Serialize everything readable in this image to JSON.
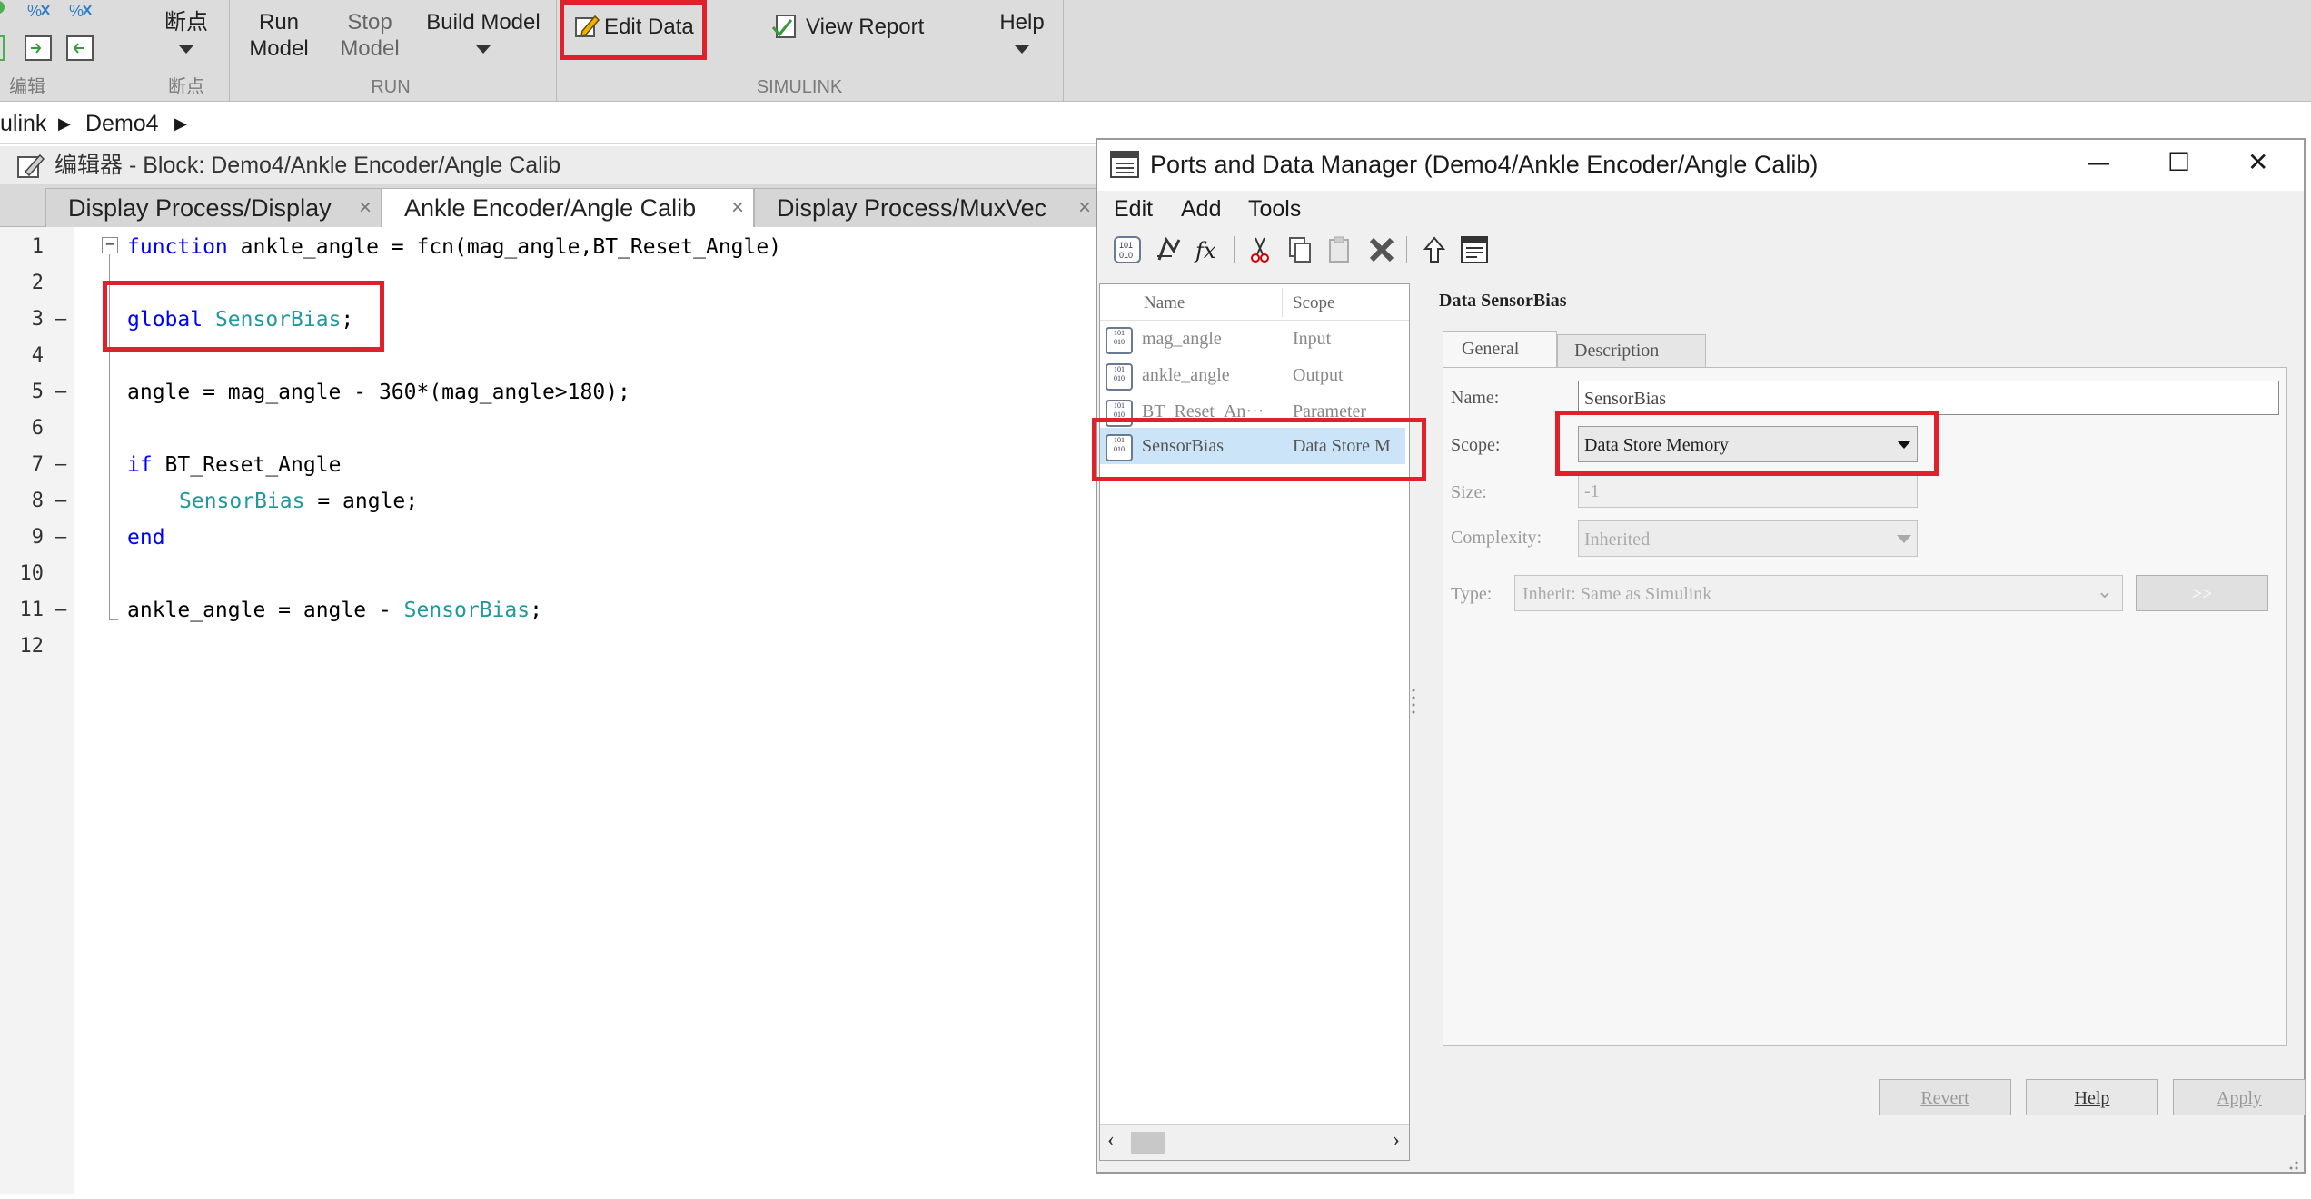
{
  "ribbon": {
    "breakpoints_label": "断点",
    "run_model": [
      "Run",
      "Model"
    ],
    "stop_model": [
      "Stop",
      "Model"
    ],
    "build_model": "Build Model",
    "edit_data": "Edit Data",
    "view_report": "View Report",
    "help": "Help",
    "sections": {
      "edit": "编辑",
      "breakpoints": "断点",
      "run": "RUN",
      "simulink": "SIMULINK"
    }
  },
  "breadcrumb": {
    "root": "ulink",
    "model": "Demo4"
  },
  "editor": {
    "title": "编辑器 - Block: Demo4/Ankle Encoder/Angle Calib",
    "tabs": [
      {
        "label": "Display Process/Display",
        "close": "×"
      },
      {
        "label": "Ankle Encoder/Angle Calib",
        "close": "×"
      },
      {
        "label": "Display Process/MuxVec",
        "close": "×"
      }
    ],
    "fold_marker": "−",
    "lines": [
      {
        "n": "1",
        "dash": ""
      },
      {
        "n": "2",
        "dash": ""
      },
      {
        "n": "3",
        "dash": "–"
      },
      {
        "n": "4",
        "dash": ""
      },
      {
        "n": "5",
        "dash": "–"
      },
      {
        "n": "6",
        "dash": ""
      },
      {
        "n": "7",
        "dash": "–"
      },
      {
        "n": "8",
        "dash": "–"
      },
      {
        "n": "9",
        "dash": "–"
      },
      {
        "n": "10",
        "dash": ""
      },
      {
        "n": "11",
        "dash": "–"
      },
      {
        "n": "12",
        "dash": ""
      }
    ],
    "code": {
      "l1_kw": "function",
      "l1_rest": " ankle_angle = fcn(mag_angle,BT_Reset_Angle)",
      "l3_kw": "global",
      "l3_var": " SensorBias",
      "l3_end": ";",
      "l5": "angle = mag_angle - 360*(mag_angle>180);",
      "l7_kw": "if",
      "l7_rest": " BT_Reset_Angle",
      "l8_var": "SensorBias",
      "l8_rest": " = angle;",
      "l9_kw": "end",
      "l11_a": "ankle_angle = angle - ",
      "l11_var": "SensorBias",
      "l11_end": ";"
    }
  },
  "dialog": {
    "title": "Ports and Data Manager (Demo4/Ankle Encoder/Angle Calib)",
    "window_buttons": {
      "minimize": "—",
      "maximize": "☐",
      "close": "✕"
    },
    "menu": [
      "Edit",
      "Add",
      "Tools"
    ],
    "list": {
      "col_name": "Name",
      "col_scope": "Scope",
      "rows": [
        {
          "name": "mag_angle",
          "scope": "Input"
        },
        {
          "name": "ankle_angle",
          "scope": "Output"
        },
        {
          "name": "BT_Reset_An···",
          "scope": "Parameter"
        },
        {
          "name": "SensorBias",
          "scope": "Data Store M"
        }
      ]
    },
    "detail": {
      "heading": "Data SensorBias",
      "tabs": [
        "General",
        "Description"
      ],
      "name_label": "Name:",
      "name_value": "SensorBias",
      "scope_label": "Scope:",
      "scope_value": "Data Store Memory",
      "size_label": "Size:",
      "size_value": "-1",
      "complexity_label": "Complexity:",
      "complexity_value": "Inherited",
      "type_label": "Type:",
      "type_value": "Inherit: Same as Simulink",
      "type_button": ">>"
    },
    "buttons": {
      "revert": "Revert",
      "help": "Help",
      "apply": "Apply"
    }
  },
  "colors": {
    "highlight": "#e0202a",
    "keyword": "#0000ff",
    "variable": "#20999d",
    "selection": "#cce4f7"
  }
}
